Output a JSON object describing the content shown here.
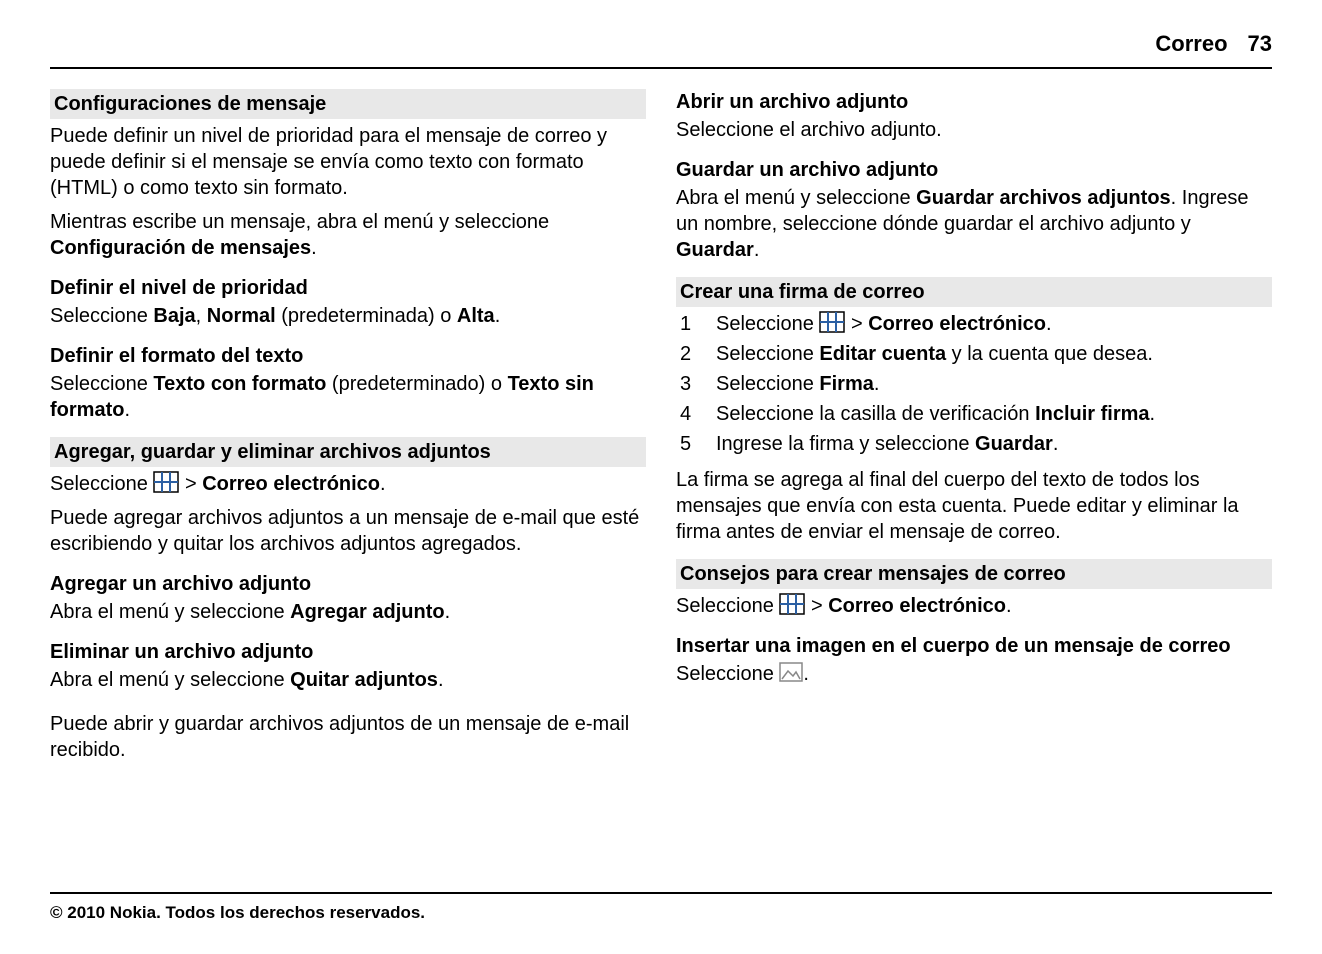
{
  "header": {
    "section": "Correo",
    "page": "73"
  },
  "col1": {
    "sec1": {
      "title": "Configuraciones de mensaje",
      "p1": "Puede definir un nivel de prioridad para el mensaje de correo y puede definir si el mensaje se envía como texto con formato (HTML) o como texto sin formato.",
      "p2a": "Mientras escribe un mensaje, abra el menú y seleccione ",
      "p2b": "Configuración de mensajes",
      "p2c": ".",
      "sub1": "Definir el nivel de prioridad",
      "s1a": "Seleccione ",
      "s1b": "Baja",
      "s1c": ", ",
      "s1d": "Normal",
      "s1e": " (predeterminada) o ",
      "s1f": "Alta",
      "s1g": ".",
      "sub2": "Definir el formato del texto",
      "s2a": "Seleccione ",
      "s2b": "Texto con formato",
      "s2c": " (predeterminado) o ",
      "s2d": "Texto sin formato",
      "s2e": "."
    },
    "sec2": {
      "title": "Agregar, guardar y eliminar archivos adjuntos",
      "p1a": "Seleccione ",
      "p1b": " > ",
      "p1c": "Correo electrónico",
      "p1d": ".",
      "p2": "Puede agregar archivos adjuntos a un mensaje de e-mail que esté escribiendo y quitar los archivos adjuntos agregados.",
      "sub1": "Agregar un archivo adjunto",
      "s1a": "Abra el menú y seleccione ",
      "s1b": "Agregar adjunto",
      "s1c": ".",
      "sub2": "Eliminar un archivo adjunto",
      "s2a": "Abra el menú y seleccione ",
      "s2b": "Quitar adjuntos",
      "s2c": ".",
      "p3": "Puede abrir y guardar archivos adjuntos de un mensaje de e-mail recibido."
    }
  },
  "col2": {
    "top": {
      "sub1": "Abrir un archivo adjunto",
      "s1": "Seleccione el archivo adjunto.",
      "sub2": "Guardar un archivo adjunto",
      "s2a": "Abra el menú y seleccione ",
      "s2b": "Guardar archivos adjuntos",
      "s2c": ". Ingrese un nombre, seleccione dónde guardar el archivo adjunto y ",
      "s2d": "Guardar",
      "s2e": "."
    },
    "sec1": {
      "title": "Crear una firma de correo",
      "li1a": "Seleccione ",
      "li1b": " > ",
      "li1c": "Correo electrónico",
      "li1d": ".",
      "li2a": "Seleccione ",
      "li2b": "Editar cuenta",
      "li2c": " y la cuenta que desea.",
      "li3a": "Seleccione ",
      "li3b": "Firma",
      "li3c": ".",
      "li4a": "Seleccione la casilla de verificación ",
      "li4b": "Incluir firma",
      "li4c": ".",
      "li5a": "Ingrese la firma y seleccione ",
      "li5b": "Guardar",
      "li5c": ".",
      "p1": "La firma se agrega al final del cuerpo del texto de todos los mensajes que envía con esta cuenta. Puede editar y eliminar la firma antes de enviar el mensaje de correo."
    },
    "sec2": {
      "title": "Consejos para crear mensajes de correo",
      "p1a": "Seleccione ",
      "p1b": " > ",
      "p1c": "Correo electrónico",
      "p1d": ".",
      "sub1": "Insertar una imagen en el cuerpo de un mensaje de correo",
      "s1a": "Seleccione ",
      "s1b": "."
    }
  },
  "footer": "© 2010 Nokia. Todos los derechos reservados."
}
